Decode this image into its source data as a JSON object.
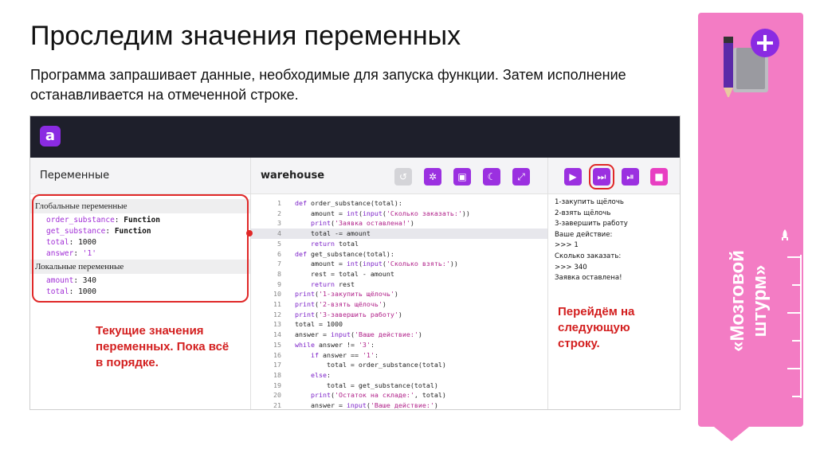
{
  "slide": {
    "title": "Проследим значения переменных",
    "subtitle": "Программа запрашивает данные, необходимые для запуска функции. Затем исполнение останавливается на отмеченной строке.",
    "ribbon_text_line1": "«Мозговой",
    "ribbon_text_line2": "штурм»"
  },
  "ide": {
    "logo": "a",
    "variables_header": "Переменные",
    "file_name": "warehouse",
    "file_toolbar": [
      {
        "name": "undo-icon",
        "glyph": "↺",
        "enabled": false
      },
      {
        "name": "debug-bug-icon",
        "glyph": "✲",
        "enabled": true
      },
      {
        "name": "save-icon",
        "glyph": "▣",
        "enabled": true
      },
      {
        "name": "theme-moon-icon",
        "glyph": "☾",
        "enabled": true
      },
      {
        "name": "fullscreen-icon",
        "glyph": "⤢",
        "enabled": true
      }
    ],
    "run_toolbar": [
      {
        "name": "run-play-icon",
        "glyph": "▶"
      },
      {
        "name": "step-next-icon",
        "glyph": "⏭"
      },
      {
        "name": "continue-icon",
        "glyph": "⏯"
      },
      {
        "name": "stop-icon",
        "glyph": "■"
      }
    ],
    "globals_title": "Глобальные переменные",
    "globals": [
      {
        "name": "order_substance",
        "value": "Function",
        "kind": "fn"
      },
      {
        "name": "get_substance",
        "value": "Function",
        "kind": "fn"
      },
      {
        "name": "total",
        "value": "1000",
        "kind": "num"
      },
      {
        "name": "answer",
        "value": "'1'",
        "kind": "str"
      }
    ],
    "locals_title": "Локальные переменные",
    "locals": [
      {
        "name": "amount",
        "value": "340",
        "kind": "num"
      },
      {
        "name": "total",
        "value": "1000",
        "kind": "num"
      }
    ],
    "breakpoint_line": 4,
    "code_lines": [
      "def order_substance(total):",
      "    amount = int(input('Сколько заказать:'))",
      "    print('Заявка оставлена!')",
      "    total -= amount",
      "    return total",
      "def get_substance(total):",
      "    amount = int(input('Сколько взять:'))",
      "    rest = total - amount",
      "    return rest",
      "print('1-закупить щёлочь')",
      "print('2-взять щёлочь')",
      "print('3-завершить работу')",
      "total = 1000",
      "answer = input('Ваше действие:')",
      "while answer != '3':",
      "    if answer == '1':",
      "        total = order_substance(total)",
      "    else:",
      "        total = get_substance(total)",
      "    print('Остаток на складе:', total)",
      "    answer = input('Ваше действие:')"
    ],
    "output_lines": [
      "1-закупить щёлочь",
      "2-взять щёлочь",
      "3-завершить работу",
      "Ваше действие:",
      ">>> 1",
      "Сколько заказать:",
      ">>> 340",
      "Заявка оставлена!"
    ]
  },
  "annotations": {
    "left": "Текущие значения переменных. Пока всё в порядке.",
    "right": "Перейдём на следующую строку."
  },
  "colors": {
    "accent_purple": "#9b30e0",
    "ribbon_pink": "#f37cc4",
    "annotation_red": "#d31f1f"
  }
}
